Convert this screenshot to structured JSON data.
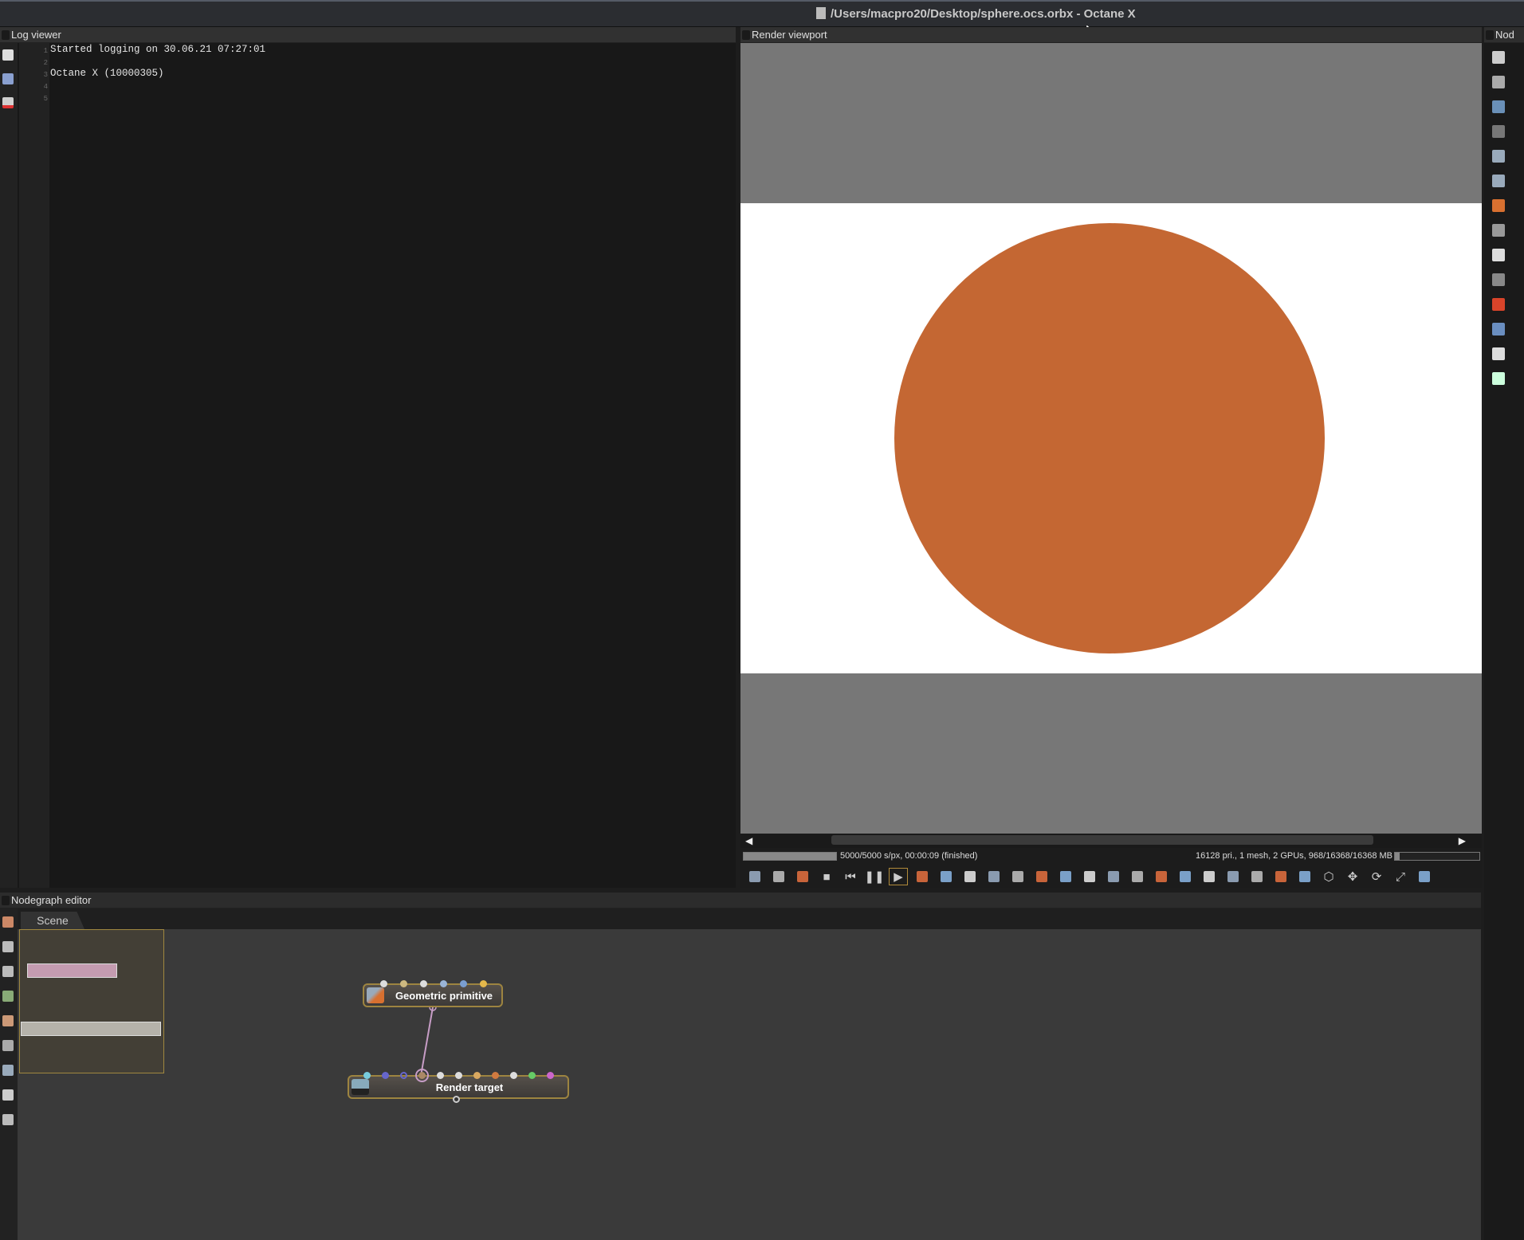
{
  "window": {
    "title": "/Users/macpro20/Desktop/sphere.ocs.orbx - Octane X"
  },
  "log_viewer": {
    "title": "Log viewer",
    "line_numbers": [
      "1",
      "2",
      "3",
      "4",
      "5"
    ],
    "lines": [
      "Started logging on 30.06.21 07:27:01",
      "",
      "Octane X (10000305)",
      "",
      ""
    ]
  },
  "render_viewport": {
    "title": "Render viewport",
    "progress_percent": 100,
    "status_left": "5000/5000 s/px, 00:00:09 (finished)",
    "status_right": "16128 pri., 1 mesh, 2 GPUs, 968/16368/16368 MB",
    "toolbar_icons": [
      "recenter-icon",
      "zoom-fit-icon",
      "color-cube-icon",
      "stop-icon",
      "restart-icon",
      "pause-icon",
      "play-icon",
      "region-render-icon",
      "af-icon",
      "color-picker-icon",
      "material-picker-icon",
      "object-picker-icon",
      "camera-target-icon",
      "focus-picker-icon",
      "white-balance-icon",
      "zoom-icon",
      "clay-mode-icon",
      "subsampling-icon",
      "copy-clipboard-icon",
      "save-render-icon",
      "export-passes-icon",
      "background-image-icon",
      "gamut-icon",
      "lock-icon",
      "viewport-cube-icon",
      "move-icon",
      "rotate-icon",
      "fullscreen-icon",
      "axes-icon"
    ],
    "sphere_color": "#c46733"
  },
  "right_panel": {
    "title": "Nod"
  },
  "nodegraph": {
    "title": "Nodegraph editor",
    "tab": "Scene",
    "nodes": [
      {
        "label": "Geometric primitive"
      },
      {
        "label": "Render target"
      }
    ]
  }
}
